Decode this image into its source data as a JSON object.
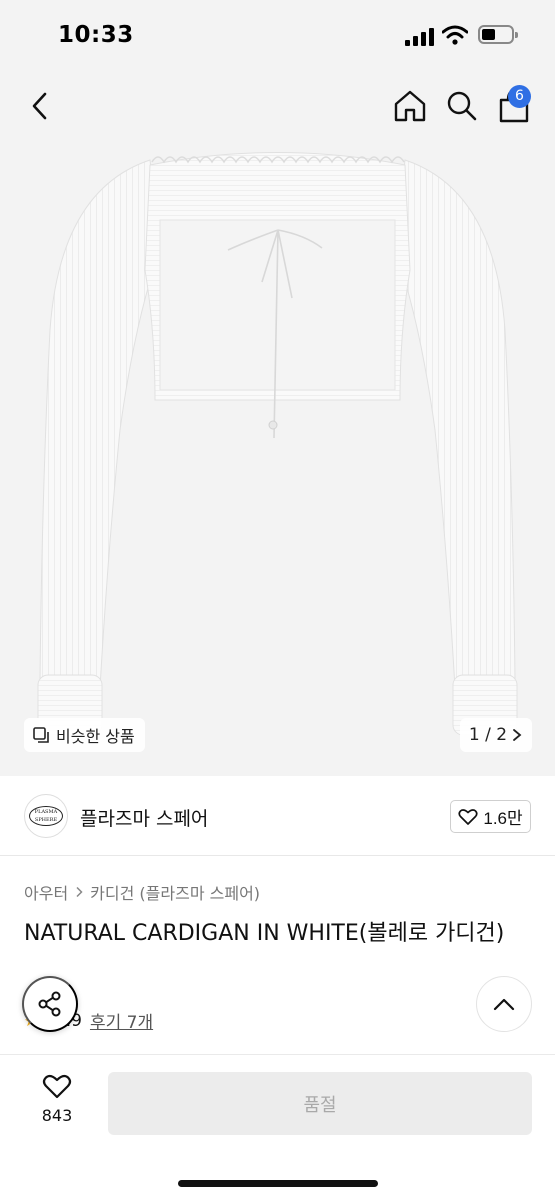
{
  "status_bar": {
    "time": "10:33"
  },
  "top_nav": {
    "cart_count": "6"
  },
  "hero": {
    "similar_label": "비슷한 상품",
    "page_indicator": "1 / 2"
  },
  "brand": {
    "logo_text_top": "PLASMA",
    "logo_text_bottom": "SPHERE",
    "name": "플라즈마 스페어",
    "likes": "1.6만"
  },
  "product": {
    "breadcrumb": [
      "아우터",
      "카디건 (플라즈마 스페어)"
    ],
    "title": "NATURAL CARDIGAN IN WHITE(볼레로 가디건)",
    "rating_score": "4.9",
    "reviews_label": "후기 7개"
  },
  "bottom_bar": {
    "wish_count": "843",
    "buy_label": "품절"
  },
  "colors": {
    "accent": "#2f6fe4",
    "star": "#f2b01e",
    "background_gray": "#f3f3f3"
  }
}
